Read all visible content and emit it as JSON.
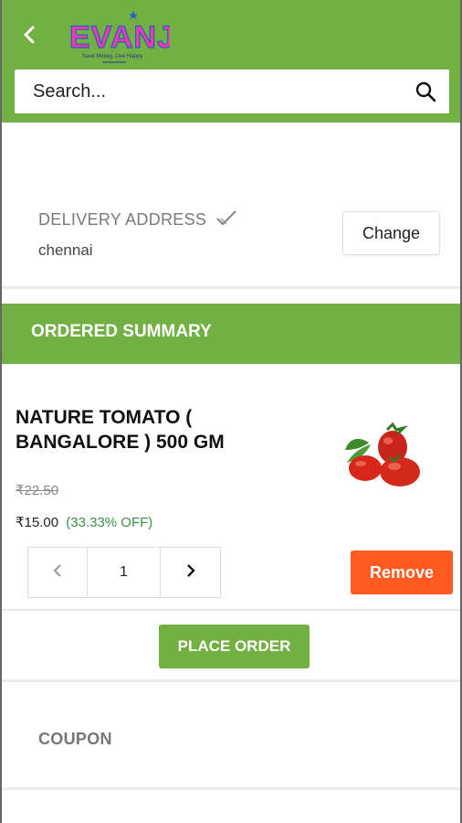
{
  "header": {
    "logo_text": "EVANJ",
    "logo_tagline": "Save Money, Live Happy",
    "search_placeholder": "Search...",
    "accent_color": "#72b043"
  },
  "delivery": {
    "title": "DELIVERY ADDRESS",
    "address": "chennai",
    "change_label": "Change"
  },
  "summary": {
    "title": "ORDERED SUMMARY"
  },
  "product": {
    "name": "NATURE TOMATO ( BANGALORE ) 500 GM",
    "old_price": "₹22.50",
    "price": "₹15.00",
    "discount": "(33.33% OFF)",
    "quantity": "1",
    "remove_label": "Remove",
    "image_icon": "tomato-image"
  },
  "actions": {
    "place_order_label": "PLACE ORDER"
  },
  "coupon": {
    "title": "COUPON"
  },
  "colors": {
    "brand_green": "#72b043",
    "remove_orange": "#ff5a1f",
    "discount_green": "#3d8f43"
  }
}
